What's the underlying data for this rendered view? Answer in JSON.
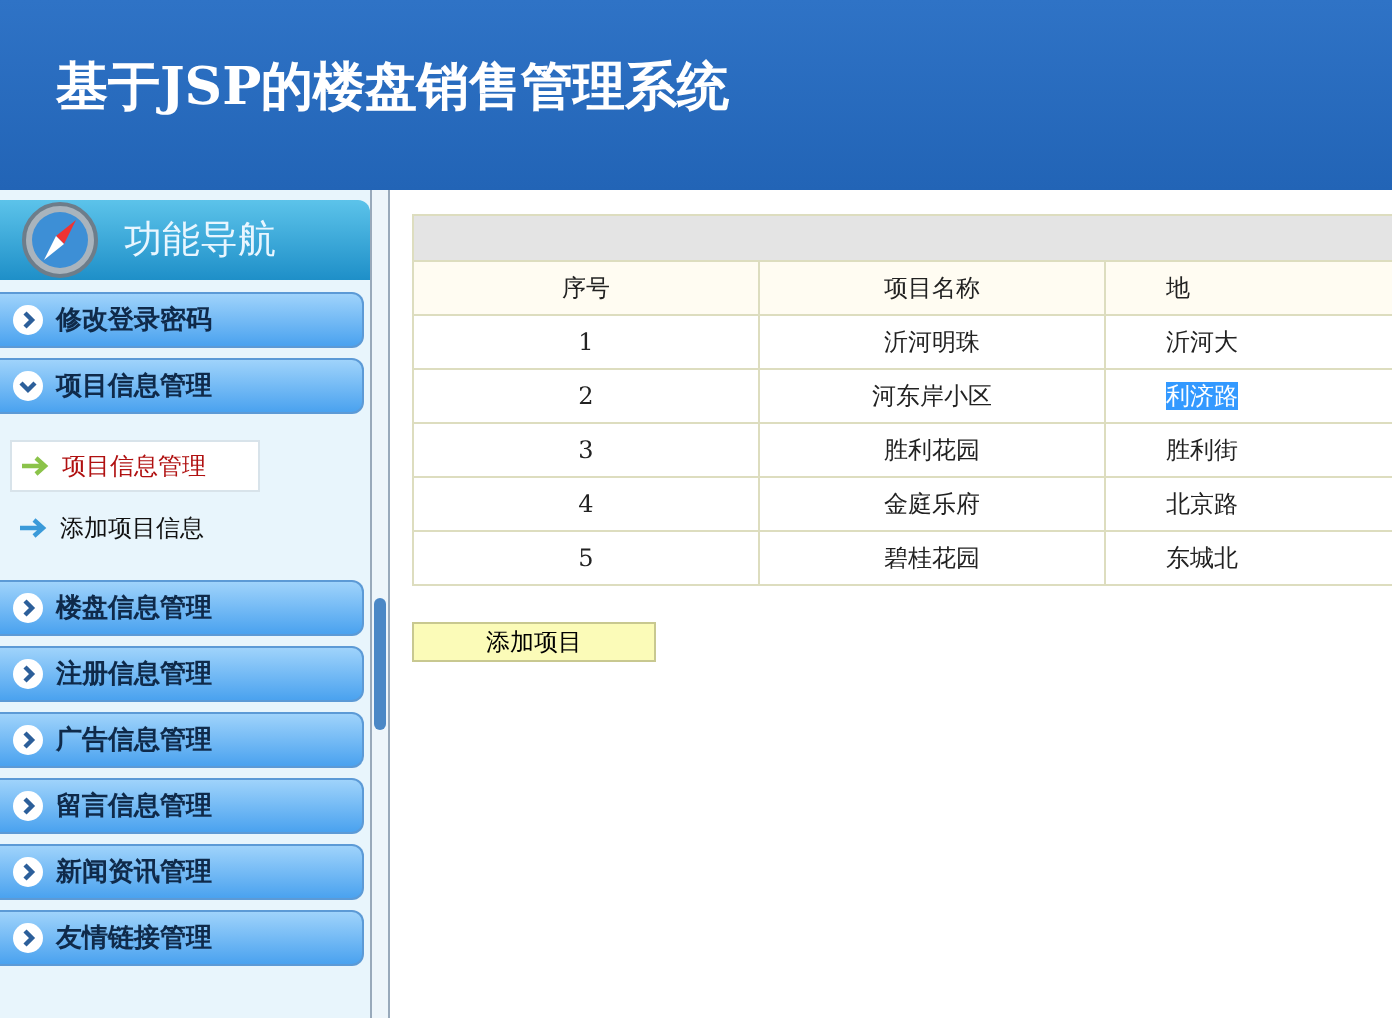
{
  "header": {
    "title": "基于JSP的楼盘销售管理系统"
  },
  "sidebar": {
    "title": "功能导航",
    "menus": [
      {
        "label": "修改登录密码",
        "expanded": false
      },
      {
        "label": "项目信息管理",
        "expanded": true,
        "children": [
          {
            "label": "项目信息管理",
            "selected": true
          },
          {
            "label": "添加项目信息",
            "selected": false
          }
        ]
      },
      {
        "label": "楼盘信息管理",
        "expanded": false
      },
      {
        "label": "注册信息管理",
        "expanded": false
      },
      {
        "label": "广告信息管理",
        "expanded": false
      },
      {
        "label": "留言信息管理",
        "expanded": false
      },
      {
        "label": "新闻资讯管理",
        "expanded": false
      },
      {
        "label": "友情链接管理",
        "expanded": false
      }
    ]
  },
  "table": {
    "columns": [
      "序号",
      "项目名称",
      "地"
    ],
    "rows": [
      {
        "cells": [
          "1",
          "沂河明珠",
          "沂河大"
        ],
        "address_highlighted": false
      },
      {
        "cells": [
          "2",
          "河东岸小区",
          "利济路"
        ],
        "address_highlighted": true
      },
      {
        "cells": [
          "3",
          "胜利花园",
          "胜利街"
        ],
        "address_highlighted": false
      },
      {
        "cells": [
          "4",
          "金庭乐府",
          "北京路"
        ],
        "address_highlighted": false
      },
      {
        "cells": [
          "5",
          "碧桂花园",
          "东城北"
        ],
        "address_highlighted": false
      }
    ]
  },
  "add_button": "添加项目"
}
